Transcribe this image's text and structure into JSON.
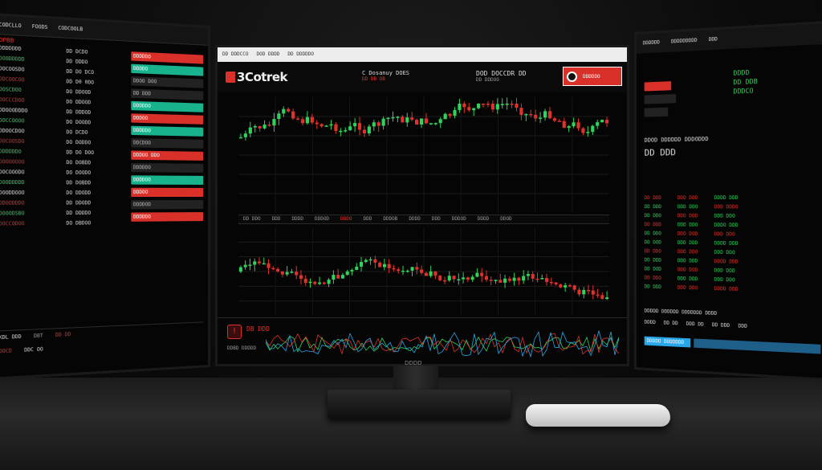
{
  "colors": {
    "up": "#2fd35c",
    "down": "#e0322c",
    "accent_green": "#18b38c",
    "accent_blue": "#29a7e8"
  },
  "left_monitor": {
    "header": [
      "CODCLLO",
      "FOODS",
      "CODCOOLB"
    ],
    "title": "OPBB",
    "col1": [
      "DDDDDDD",
      "DOODDDDD",
      "DOCOOSDO",
      "DDCOOCOO",
      "DOSCDOO",
      "DOCCCDOO",
      "DDOOODDDO",
      "DOCCOOOO",
      "DDOOCDOO",
      "DOCOOSDO",
      "DDDDDDO",
      "DOOOOOOO",
      "DOCOOODO",
      "DOODDDDD",
      "DOODDOOO",
      "DDOODDDO",
      "DOOODSBO",
      "DOCCODOO"
    ],
    "col2": [
      "DD DCDO",
      "DD DDDO",
      "DD DO DCO",
      "DD D0 0DO",
      "DO DDOOD",
      "DO DDOOD",
      "DD DDDOD",
      "DO DOODD",
      "DO DCDO",
      "DO DODDO",
      "DD DO DOO",
      "DO DOBDD",
      "DO DOODO",
      "DD DOBDD",
      "DO DDODD",
      "DD DDODD",
      "DD DDDDO",
      "DO DBDOO"
    ],
    "buttons": [
      {
        "label": "DDDDDO",
        "style": "r"
      },
      {
        "label": "DDDDO",
        "style": "g"
      },
      {
        "label": "DDOO DOO",
        "style": "dk"
      },
      {
        "label": "DD DDD",
        "style": "dk"
      },
      {
        "label": "DDDDDO",
        "style": "g"
      },
      {
        "label": "DDDOO",
        "style": "r"
      },
      {
        "label": "DDDDDO",
        "style": "g"
      },
      {
        "label": "DDCDOO",
        "style": "dk"
      },
      {
        "label": "DDDOO DDO",
        "style": "r"
      },
      {
        "label": "DDDDDO",
        "style": "dk"
      },
      {
        "label": "DDDDOO",
        "style": "g"
      },
      {
        "label": "DDDOO",
        "style": "r"
      },
      {
        "label": "DDDDOD",
        "style": "dk"
      },
      {
        "label": "DDDDDO",
        "style": "r"
      }
    ],
    "footer": [
      "KDL DDD",
      "DBT",
      "DD DD",
      "OOCD",
      "DDC OO"
    ]
  },
  "center_monitor": {
    "browser_tabs": [
      "DD DDDCCO",
      "DOD DDDD",
      "DD DDDDDO"
    ],
    "logo": "3Cotrek",
    "ticker": "C Dosanuy  DOES",
    "ticker_sub": "DD DB OB",
    "price_title": "DOD DOCCDR DD",
    "price_sub": "DD DDDOO",
    "alert_text": "DDDDDO",
    "mid_bar": [
      "DD DDO",
      "DDD",
      "DDDD",
      "DDDOD",
      "DDDO",
      "DDD",
      "DDDOB",
      "DDDD",
      "DDD",
      "DDDOD",
      "DDDD",
      "DDOD"
    ],
    "bottom_label": "DB DDD",
    "bottom_sub": "DDBD DDDDD"
  },
  "right_monitor": {
    "header": [
      "DDDDDD",
      "DDDDDDDDD",
      "DDD"
    ],
    "top_green": [
      "DDDD",
      "DD DDB",
      "DDDCO"
    ],
    "section_title": "DDOD DDDDDD DDDODDD",
    "big_value": "DD DDD",
    "col_a": [
      "DD DDD",
      "DD DDD",
      "DD DDO",
      "DD DDD",
      "DD DDO",
      "DD DOD",
      "DD DDO",
      "DD DDD",
      "DD DOD",
      "DD DDO",
      "DD DDD"
    ],
    "col_b": [
      "DDD DDD",
      "DDD DDO",
      "DDD DDD",
      "DDD DDO",
      "DDD DOD",
      "DDD DDD",
      "DDD DDO",
      "DDD DDD",
      "DDD DOD",
      "DDD DDD",
      "DDD DDO"
    ],
    "col_c": [
      "DDDD DDD",
      "DDD DDDO",
      "DDD DDO",
      "DDDO DDD",
      "DDD DDO",
      "DDDD DDD",
      "DDD DDO",
      "DDDD DDD",
      "DDD DDD",
      "DDD DDO",
      "DDDD DDD"
    ],
    "footer_title": "DDDDD DDDDDD DDDDDDD DDDD",
    "footer_values": [
      "DDDD",
      "DD DD",
      "DDD DD",
      "DD DDD",
      "DDD"
    ],
    "blue_label": "DDDDD DDDDDDD"
  },
  "monitor_brand": "DDDD"
}
